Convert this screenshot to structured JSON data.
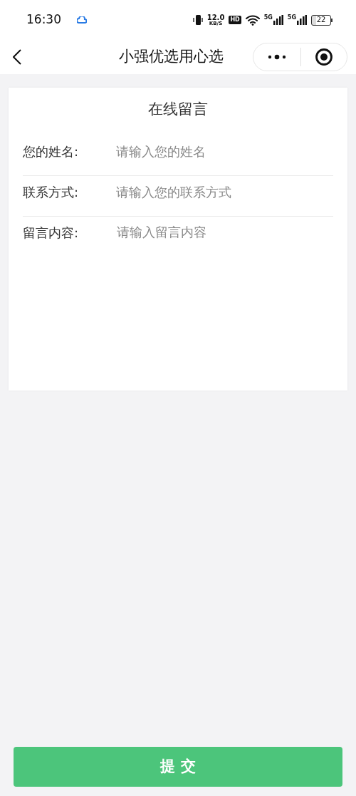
{
  "status_bar": {
    "time": "16:30",
    "speed": "12.0",
    "speed_unit": "KB/S",
    "hd": "HD",
    "signals": [
      "5G",
      "5G"
    ],
    "battery": "22"
  },
  "nav": {
    "title": "小强优选用心选"
  },
  "form": {
    "title": "在线留言",
    "fields": [
      {
        "kind": "input",
        "label": "您的姓名:",
        "placeholder": "请输入您的姓名"
      },
      {
        "kind": "input",
        "label": "联系方式:",
        "placeholder": "请输入您的联系方式"
      },
      {
        "kind": "textarea",
        "label": "留言内容:",
        "placeholder": "请输入留言内容"
      }
    ]
  },
  "submit": {
    "label": "提 交"
  }
}
